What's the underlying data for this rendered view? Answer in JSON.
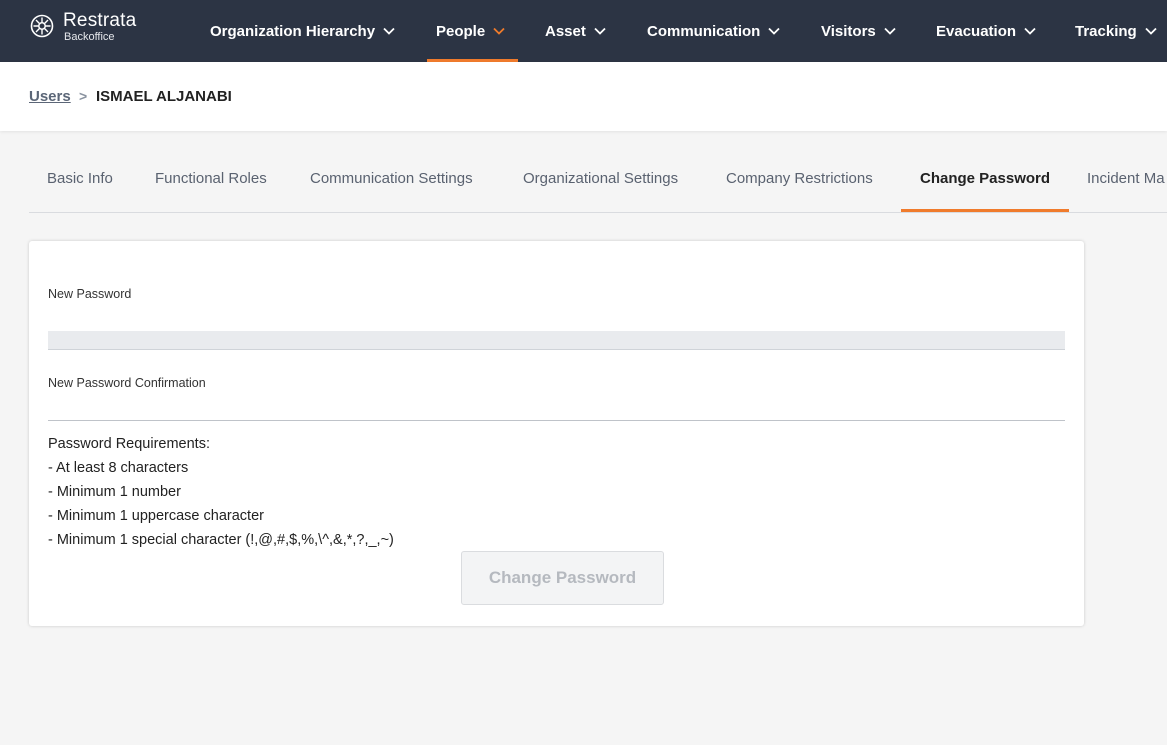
{
  "app": {
    "name": "Restrata",
    "subtitle": "Backoffice"
  },
  "nav": {
    "items": [
      {
        "label": "Organization Hierarchy"
      },
      {
        "label": "People"
      },
      {
        "label": "Asset"
      },
      {
        "label": "Communication"
      },
      {
        "label": "Visitors"
      },
      {
        "label": "Evacuation"
      },
      {
        "label": "Tracking"
      }
    ],
    "active": "People"
  },
  "breadcrumb": {
    "parent": "Users",
    "separator": ">",
    "current": "ISMAEL ALJANABI"
  },
  "tabs": {
    "items": [
      {
        "label": "Basic Info"
      },
      {
        "label": "Functional Roles"
      },
      {
        "label": "Communication Settings"
      },
      {
        "label": "Organizational Settings"
      },
      {
        "label": "Company Restrictions"
      },
      {
        "label": "Change Password"
      },
      {
        "label": "Incident Ma"
      }
    ],
    "active": "Change Password"
  },
  "form": {
    "new_password_label": "New Password",
    "new_password_value": "",
    "confirm_label": "New Password Confirmation",
    "confirm_value": "",
    "requirements": {
      "title": "Password Requirements:",
      "items": [
        "- At least 8 characters",
        "- Minimum 1 number",
        "- Minimum 1 uppercase character",
        "- Minimum 1 special character (!,@,#,$,%,\\^,&,*,?,_,~)"
      ]
    },
    "submit_label": "Change Password"
  },
  "colors": {
    "nav_bg": "#2c3444",
    "accent": "#f07b2c",
    "page_bg": "#f5f5f5"
  },
  "icons": {
    "logo": "restrata-logo-icon",
    "caret": "chevron-down-icon"
  }
}
